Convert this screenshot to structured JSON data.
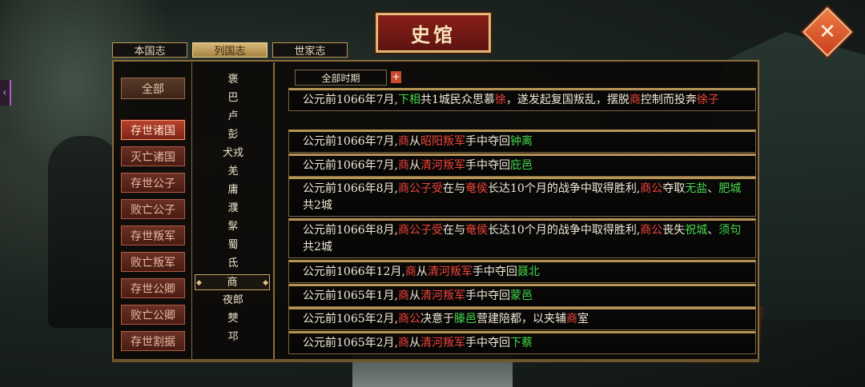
{
  "title": "史馆",
  "top_tabs": [
    "本国志",
    "列国志",
    "世家志"
  ],
  "active_tab": 1,
  "categories": {
    "all_label": "全部",
    "items": [
      "存世诸国",
      "灭亡诸国",
      "存世公子",
      "败亡公子",
      "存世叛军",
      "败亡叛军",
      "存世公卿",
      "败亡公卿",
      "存世割据"
    ],
    "active": 0
  },
  "countries": [
    "褒",
    "巴",
    "卢",
    "彭",
    "犬戎",
    "羌",
    "庸",
    "濮",
    "髳",
    "蜀",
    "氐",
    "商",
    "夜郎",
    "僰",
    "邛"
  ],
  "selected_country": "商",
  "period": {
    "label": "全部时期",
    "plus": "+"
  },
  "events": [
    {
      "segments": [
        [
          "公元前1066年7月,",
          ""
        ],
        [
          "下相",
          "g"
        ],
        [
          "共1城民众思慕",
          ""
        ],
        [
          "徐",
          "r"
        ],
        [
          "，遂发起复国叛乱，摆脱",
          ""
        ],
        [
          "商",
          "r"
        ],
        [
          "控制而投奔",
          ""
        ],
        [
          "徐子",
          "r"
        ]
      ]
    },
    {
      "segments": [
        [
          "公元前1066年7月,",
          ""
        ],
        [
          "商",
          "r"
        ],
        [
          "从",
          ""
        ],
        [
          "昭阳叛军",
          "r"
        ],
        [
          "手中夺回",
          ""
        ],
        [
          "钟离",
          "g"
        ]
      ]
    },
    {
      "segments": [
        [
          "公元前1066年7月,",
          ""
        ],
        [
          "商",
          "r"
        ],
        [
          "从",
          ""
        ],
        [
          "清河叛军",
          "r"
        ],
        [
          "手中夺回",
          ""
        ],
        [
          "庇邑",
          "g"
        ]
      ]
    },
    {
      "segments": [
        [
          "公元前1066年8月,",
          ""
        ],
        [
          "商公子受",
          "r"
        ],
        [
          "在与",
          ""
        ],
        [
          "奄侯",
          "r"
        ],
        [
          "长达10个月的战争中取得胜利,",
          ""
        ],
        [
          "商公",
          "r"
        ],
        [
          "夺取",
          ""
        ],
        [
          "无盐",
          "g"
        ],
        [
          "、",
          ""
        ],
        [
          "肥城",
          "g"
        ],
        [
          "共2城",
          ""
        ]
      ]
    },
    {
      "segments": [
        [
          "公元前1066年8月,",
          ""
        ],
        [
          "商公子受",
          "r"
        ],
        [
          "在与",
          ""
        ],
        [
          "奄侯",
          "r"
        ],
        [
          "长达10个月的战争中取得胜利,",
          ""
        ],
        [
          "商公",
          "r"
        ],
        [
          "丧失",
          ""
        ],
        [
          "祝城",
          "g"
        ],
        [
          "、",
          ""
        ],
        [
          "须句",
          "g"
        ],
        [
          "共2城",
          ""
        ]
      ]
    },
    {
      "segments": [
        [
          "公元前1066年12月,",
          ""
        ],
        [
          "商",
          "r"
        ],
        [
          "从",
          ""
        ],
        [
          "清河叛军",
          "r"
        ],
        [
          "手中夺回",
          ""
        ],
        [
          "聂北",
          "g"
        ]
      ]
    },
    {
      "segments": [
        [
          "公元前1065年1月,",
          ""
        ],
        [
          "商",
          "r"
        ],
        [
          "从",
          ""
        ],
        [
          "清河叛军",
          "r"
        ],
        [
          "手中夺回",
          ""
        ],
        [
          "蒙邑",
          "g"
        ]
      ]
    },
    {
      "segments": [
        [
          "公元前1065年2月,",
          ""
        ],
        [
          "商公",
          "r"
        ],
        [
          "决意于",
          ""
        ],
        [
          "滕邑",
          "g"
        ],
        [
          "营建陪都，以夹辅",
          ""
        ],
        [
          "商",
          "r"
        ],
        [
          "室",
          ""
        ]
      ]
    },
    {
      "segments": [
        [
          "公元前1065年2月,",
          ""
        ],
        [
          "商",
          "r"
        ],
        [
          "从",
          ""
        ],
        [
          "清河叛军",
          "r"
        ],
        [
          "手中夺回",
          ""
        ],
        [
          "下蔡",
          "g"
        ]
      ]
    }
  ],
  "colors": {
    "red": "#f0443a",
    "green": "#43d84a",
    "gold": "#b59455"
  },
  "icons": {
    "close": "close-icon",
    "side": "chevron-left-icon",
    "plus": "plus-icon"
  }
}
